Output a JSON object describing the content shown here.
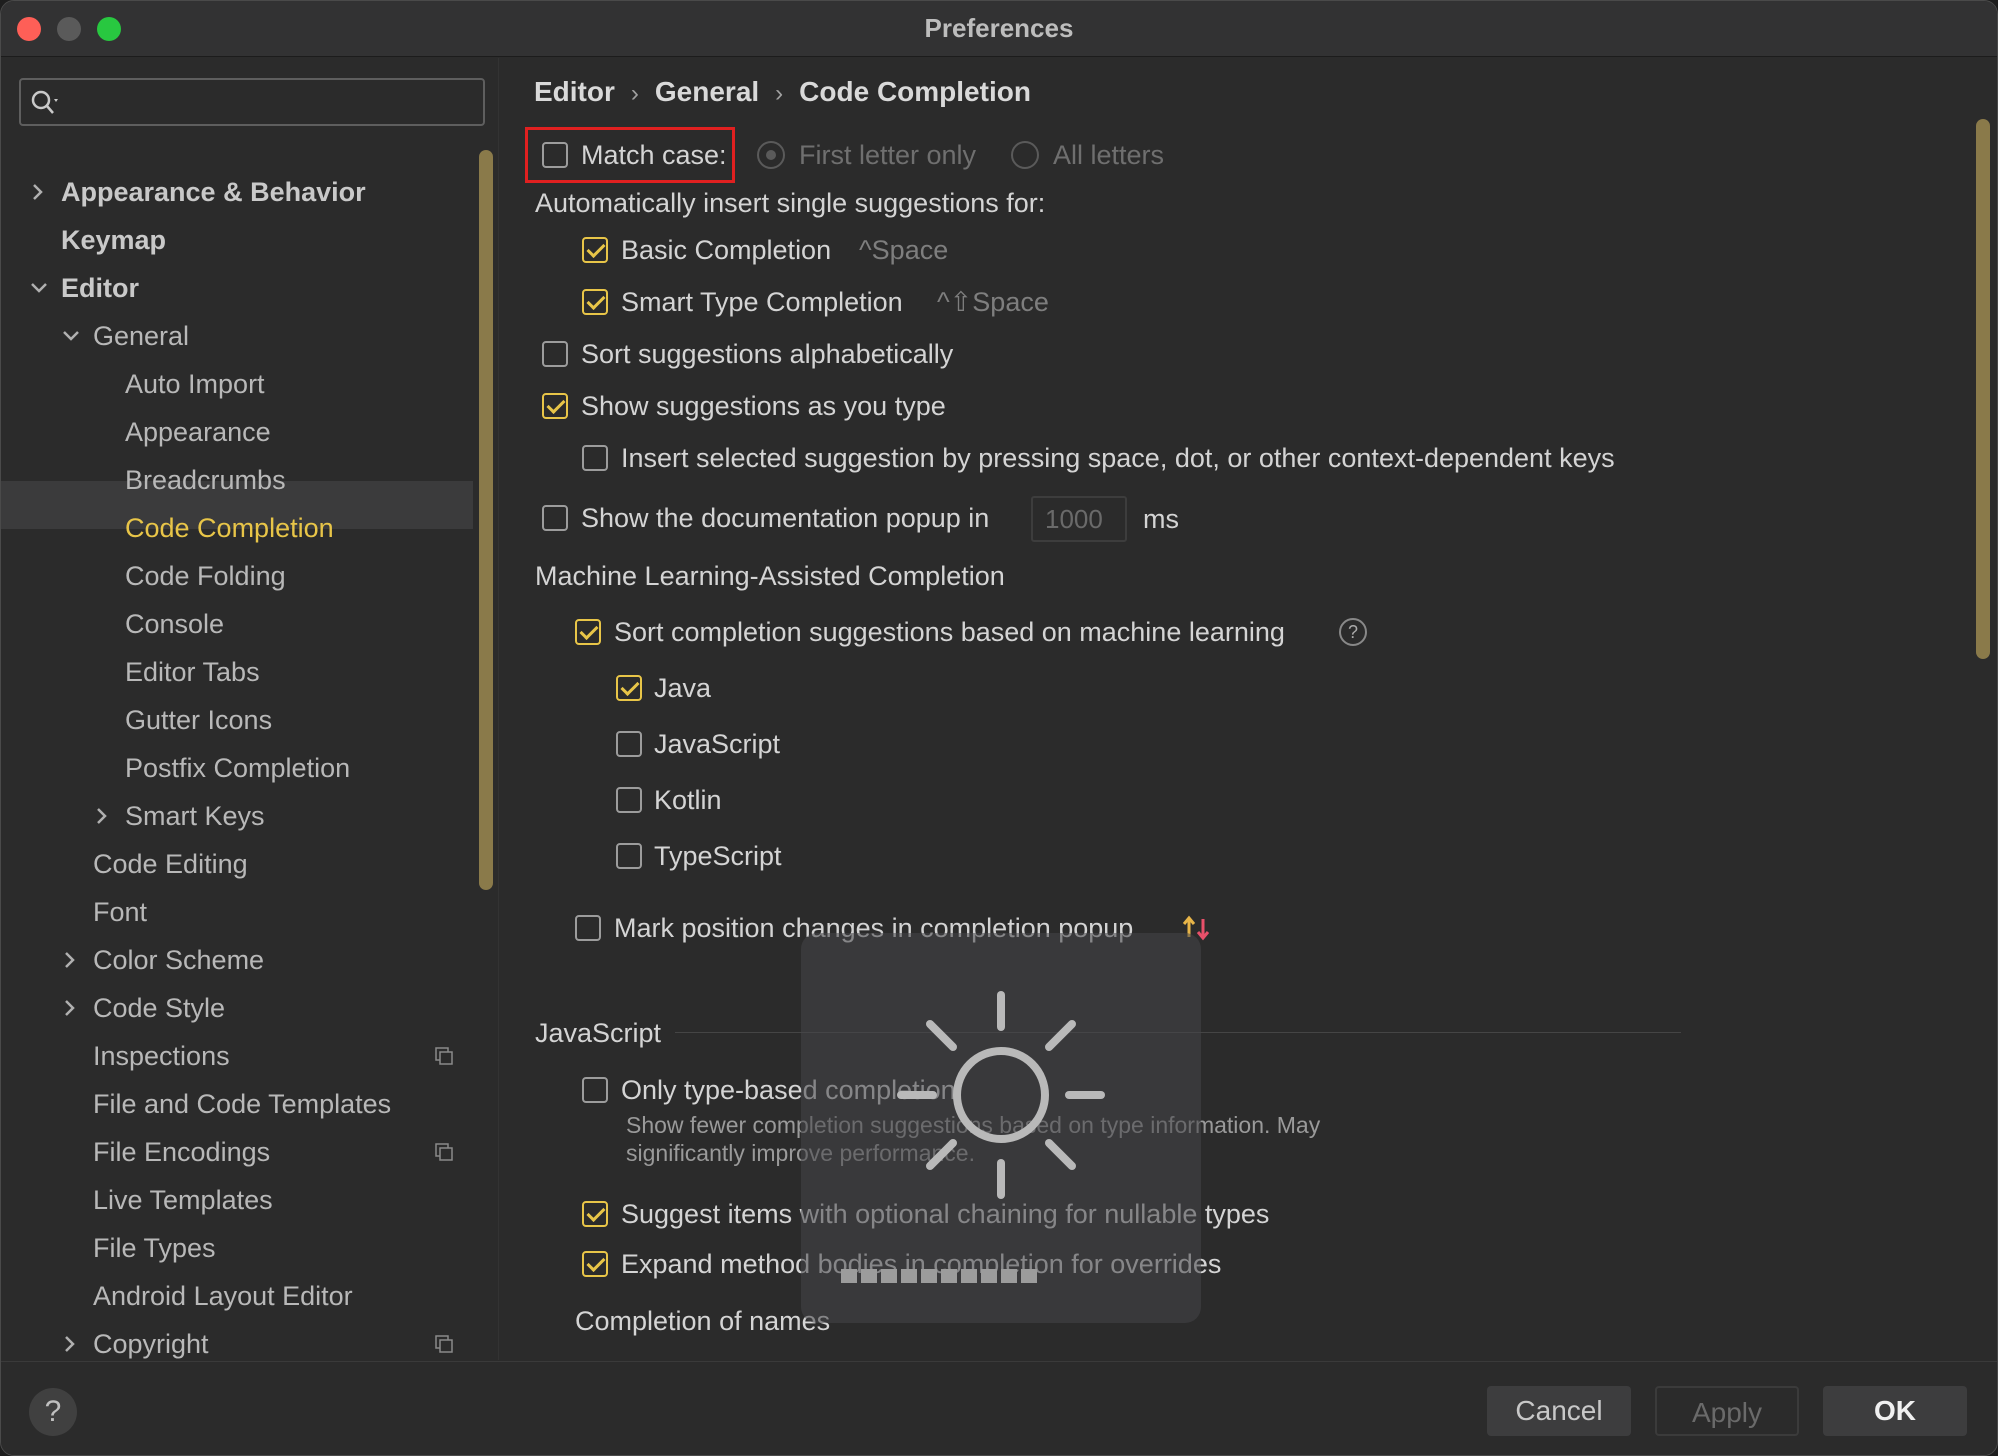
{
  "window": {
    "title": "Preferences"
  },
  "search": {
    "placeholder": ""
  },
  "sidebar": {
    "items": [
      {
        "label": "Appearance & Behavior"
      },
      {
        "label": "Keymap"
      },
      {
        "label": "Editor"
      },
      {
        "label": "General"
      },
      {
        "label": "Auto Import"
      },
      {
        "label": "Appearance"
      },
      {
        "label": "Breadcrumbs"
      },
      {
        "label": "Code Completion"
      },
      {
        "label": "Code Folding"
      },
      {
        "label": "Console"
      },
      {
        "label": "Editor Tabs"
      },
      {
        "label": "Gutter Icons"
      },
      {
        "label": "Postfix Completion"
      },
      {
        "label": "Smart Keys"
      },
      {
        "label": "Code Editing"
      },
      {
        "label": "Font"
      },
      {
        "label": "Color Scheme"
      },
      {
        "label": "Code Style"
      },
      {
        "label": "Inspections"
      },
      {
        "label": "File and Code Templates"
      },
      {
        "label": "File Encodings"
      },
      {
        "label": "Live Templates"
      },
      {
        "label": "File Types"
      },
      {
        "label": "Android Layout Editor"
      },
      {
        "label": "Copyright"
      }
    ]
  },
  "breadcrumb": [
    "Editor",
    "General",
    "Code Completion"
  ],
  "settings": {
    "match_case": {
      "label": "Match case:",
      "checked": false
    },
    "first_letter": "First letter only",
    "all_letters": "All letters",
    "auto_insert_heading": "Automatically insert single suggestions for:",
    "basic_completion": {
      "label": "Basic Completion",
      "shortcut": "^Space",
      "checked": true
    },
    "smart_type": {
      "label": "Smart Type Completion",
      "shortcut": "^⇧Space",
      "checked": true
    },
    "sort_alpha": {
      "label": "Sort suggestions alphabetically",
      "checked": false
    },
    "show_as_type": {
      "label": "Show suggestions as you type",
      "checked": true
    },
    "insert_selected": {
      "label": "Insert selected suggestion by pressing space, dot, or other context-dependent keys",
      "checked": false
    },
    "doc_popup": {
      "label": "Show the documentation popup in",
      "value": "1000",
      "unit": "ms",
      "checked": false
    },
    "ml_heading": "Machine Learning-Assisted Completion",
    "ml_sort": {
      "label": "Sort completion suggestions based on machine learning",
      "checked": true
    },
    "ml_java": {
      "label": "Java",
      "checked": true
    },
    "ml_javascript": {
      "label": "JavaScript",
      "checked": false
    },
    "ml_kotlin": {
      "label": "Kotlin",
      "checked": false
    },
    "ml_typescript": {
      "label": "TypeScript",
      "checked": false
    },
    "mark_position": {
      "label": "Mark position changes in completion popup",
      "checked": false
    },
    "js_heading": "JavaScript",
    "only_type_based": {
      "label": "Only type-based completion",
      "checked": false
    },
    "only_type_desc_1": "Show fewer completion suggestions based on type information. May",
    "only_type_desc_2": "significantly improve performance.",
    "optional_chaining": {
      "label": "Suggest items with optional chaining for nullable types",
      "checked": true
    },
    "expand_method": {
      "label": "Expand method bodies in completion for overrides",
      "checked": true
    },
    "completion_names": "Completion of names"
  },
  "footer": {
    "help": "?",
    "cancel": "Cancel",
    "apply": "Apply",
    "ok": "OK"
  },
  "colors": {
    "accent": "#e8c548",
    "highlight_box": "#e02020",
    "background": "#2b2b2b"
  }
}
